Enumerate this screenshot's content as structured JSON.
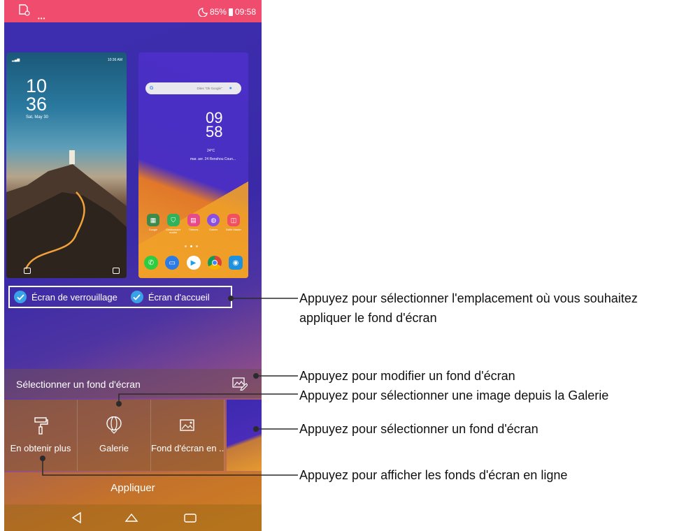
{
  "status_bar": {
    "battery": "85%",
    "time": "09:58",
    "dots": "•••"
  },
  "lock_preview": {
    "status_time": "10:36 AM",
    "hour": "10",
    "minute": "36",
    "date": "Sat, May 30"
  },
  "home_preview": {
    "search_hint": "Dites \"Ok Google\"",
    "hour": "09",
    "minute": "58",
    "temperature": "24°C",
    "location": "mar. avr. 24 Renshou Coun...",
    "apps": [
      {
        "label": "Google",
        "icon": "google-folder-icon"
      },
      {
        "label": "Gestionnaire mobile",
        "icon": "mobile-manager-icon"
      },
      {
        "label": "Thèmes",
        "icon": "themes-icon"
      },
      {
        "label": "Galerie",
        "icon": "gallery-icon"
      },
      {
        "label": "Selfie Master",
        "icon": "selfie-master-icon"
      }
    ],
    "dock": [
      {
        "icon": "phone-icon",
        "color": "#2ecc40"
      },
      {
        "icon": "messages-icon",
        "color": "#2d7be5"
      },
      {
        "icon": "play-store-icon",
        "color": "#ffffff"
      },
      {
        "icon": "chrome-icon",
        "color": "#ffffff"
      },
      {
        "icon": "camera-icon",
        "color": "#1e90e0"
      }
    ]
  },
  "screen_options": {
    "lock_screen": "Écran de verrouillage",
    "home_screen": "Écran d'accueil"
  },
  "select_bar": {
    "label": "Sélectionner un fond d'écran"
  },
  "tiles": [
    {
      "label": "En obtenir plus",
      "icon": "paint-roller-icon"
    },
    {
      "label": "Galerie",
      "icon": "balloon-icon"
    },
    {
      "label": "Fond d'écran en ..",
      "icon": "image-icon"
    }
  ],
  "apply_bar": {
    "label": "Appliquer"
  },
  "callouts": {
    "location_line1": "Appuyez pour sélectionner l'emplacement où vous souhaitez",
    "location_line2": "appliquer le fond d'écran",
    "modify": "Appuyez pour modifier un fond d'écran",
    "gallery": "Appuyez pour sélectionner une image depuis la Galerie",
    "select": "Appuyez pour sélectionner un fond d'écran",
    "online": "Appuyez pour afficher les fonds d'écran en ligne"
  },
  "colors": {
    "status_bar": "#f04d6e",
    "check_blue": "#3aa0e8",
    "callout_line": "#2b2b2b"
  }
}
